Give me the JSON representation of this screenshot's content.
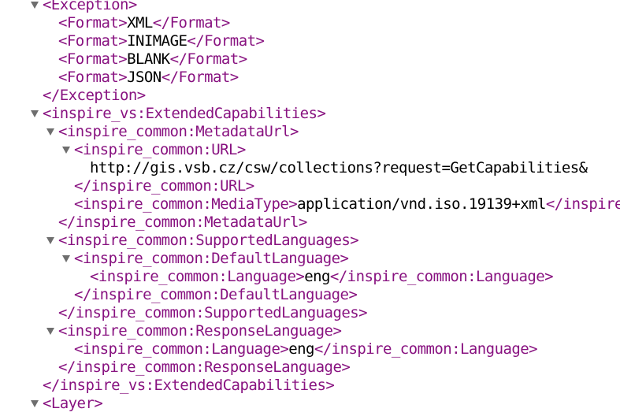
{
  "xml_viewer": {
    "lines": [
      {
        "indent": 0,
        "toggle": true,
        "open": "<Exception>"
      },
      {
        "indent": 1,
        "toggle": false,
        "open": "<Format>",
        "text": "XML",
        "close": "</Format>"
      },
      {
        "indent": 1,
        "toggle": false,
        "open": "<Format>",
        "text": "INIMAGE",
        "close": "</Format>"
      },
      {
        "indent": 1,
        "toggle": false,
        "open": "<Format>",
        "text": "BLANK",
        "close": "</Format>"
      },
      {
        "indent": 1,
        "toggle": false,
        "open": "<Format>",
        "text": "JSON",
        "close": "</Format>"
      },
      {
        "indent": 0,
        "toggle": false,
        "close": "</Exception>"
      },
      {
        "indent": 0,
        "toggle": true,
        "open": "<inspire_vs:ExtendedCapabilities>"
      },
      {
        "indent": 1,
        "toggle": true,
        "open": "<inspire_common:MetadataUrl>"
      },
      {
        "indent": 2,
        "toggle": true,
        "open": "<inspire_common:URL>"
      },
      {
        "indent": 3,
        "toggle": false,
        "text": "http://gis.vsb.cz/csw/collections?request=GetCapabilities&"
      },
      {
        "indent": 2,
        "toggle": false,
        "close": "</inspire_common:URL>"
      },
      {
        "indent": 2,
        "toggle": false,
        "open": "<inspire_common:MediaType>",
        "text": "application/vnd.iso.19139+xml",
        "close": "</inspire_common:MediaType>"
      },
      {
        "indent": 1,
        "toggle": false,
        "close": "</inspire_common:MetadataUrl>"
      },
      {
        "indent": 1,
        "toggle": true,
        "open": "<inspire_common:SupportedLanguages>"
      },
      {
        "indent": 2,
        "toggle": true,
        "open": "<inspire_common:DefaultLanguage>"
      },
      {
        "indent": 3,
        "toggle": false,
        "open": "<inspire_common:Language>",
        "text": "eng",
        "close": "</inspire_common:Language>"
      },
      {
        "indent": 2,
        "toggle": false,
        "close": "</inspire_common:DefaultLanguage>"
      },
      {
        "indent": 1,
        "toggle": false,
        "close": "</inspire_common:SupportedLanguages>"
      },
      {
        "indent": 1,
        "toggle": true,
        "open": "<inspire_common:ResponseLanguage>"
      },
      {
        "indent": 2,
        "toggle": false,
        "open": "<inspire_common:Language>",
        "text": "eng",
        "close": "</inspire_common:Language>"
      },
      {
        "indent": 1,
        "toggle": false,
        "close": "</inspire_common:ResponseLanguage>"
      },
      {
        "indent": 0,
        "toggle": false,
        "close": "</inspire_vs:ExtendedCapabilities>"
      },
      {
        "indent": 0,
        "toggle": true,
        "open": "<Layer>"
      }
    ]
  },
  "colors": {
    "tag": "#881280",
    "text": "#000000",
    "toggle": "#6e6e6e"
  }
}
